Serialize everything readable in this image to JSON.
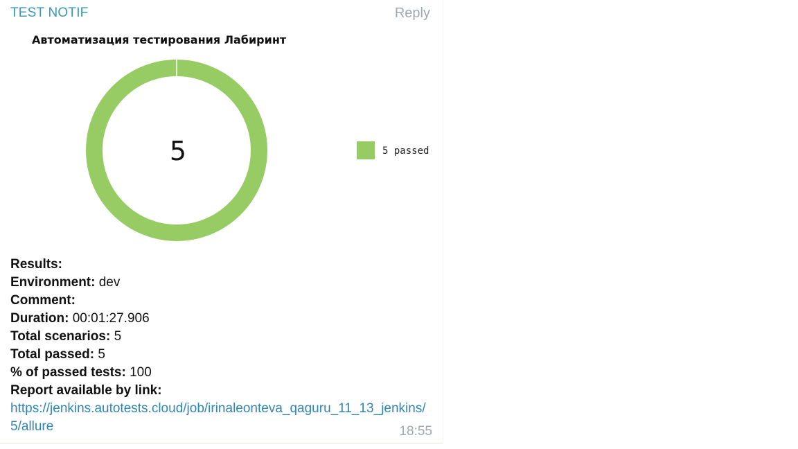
{
  "message": {
    "sender": "TEST NOTIF",
    "reply_label": "Reply",
    "time": "18:55"
  },
  "chart_data": {
    "type": "pie",
    "title": "Автоматизация тестирования Лабиринт",
    "center_label": "5",
    "slices": [
      {
        "label": "5 passed",
        "value": 5,
        "color": "#97cc64"
      }
    ],
    "legend_position": "right"
  },
  "results": {
    "header": "Results:",
    "environment_label": "Environment:",
    "environment_value": " dev",
    "comment_label": "Comment:",
    "duration_label": "Duration:",
    "duration_value": " 00:01:27.906",
    "total_scenarios_label": "Total scenarios:",
    "total_scenarios_value": " 5",
    "total_passed_label": "Total passed:",
    "total_passed_value": " 5",
    "percent_label": "% of passed tests:",
    "percent_value": " 100",
    "report_label": "Report available by link:",
    "report_link": "https://jenkins.autotests.cloud/job/irinaleonteva_qaguru_11_13_jenkins/5/allure"
  }
}
